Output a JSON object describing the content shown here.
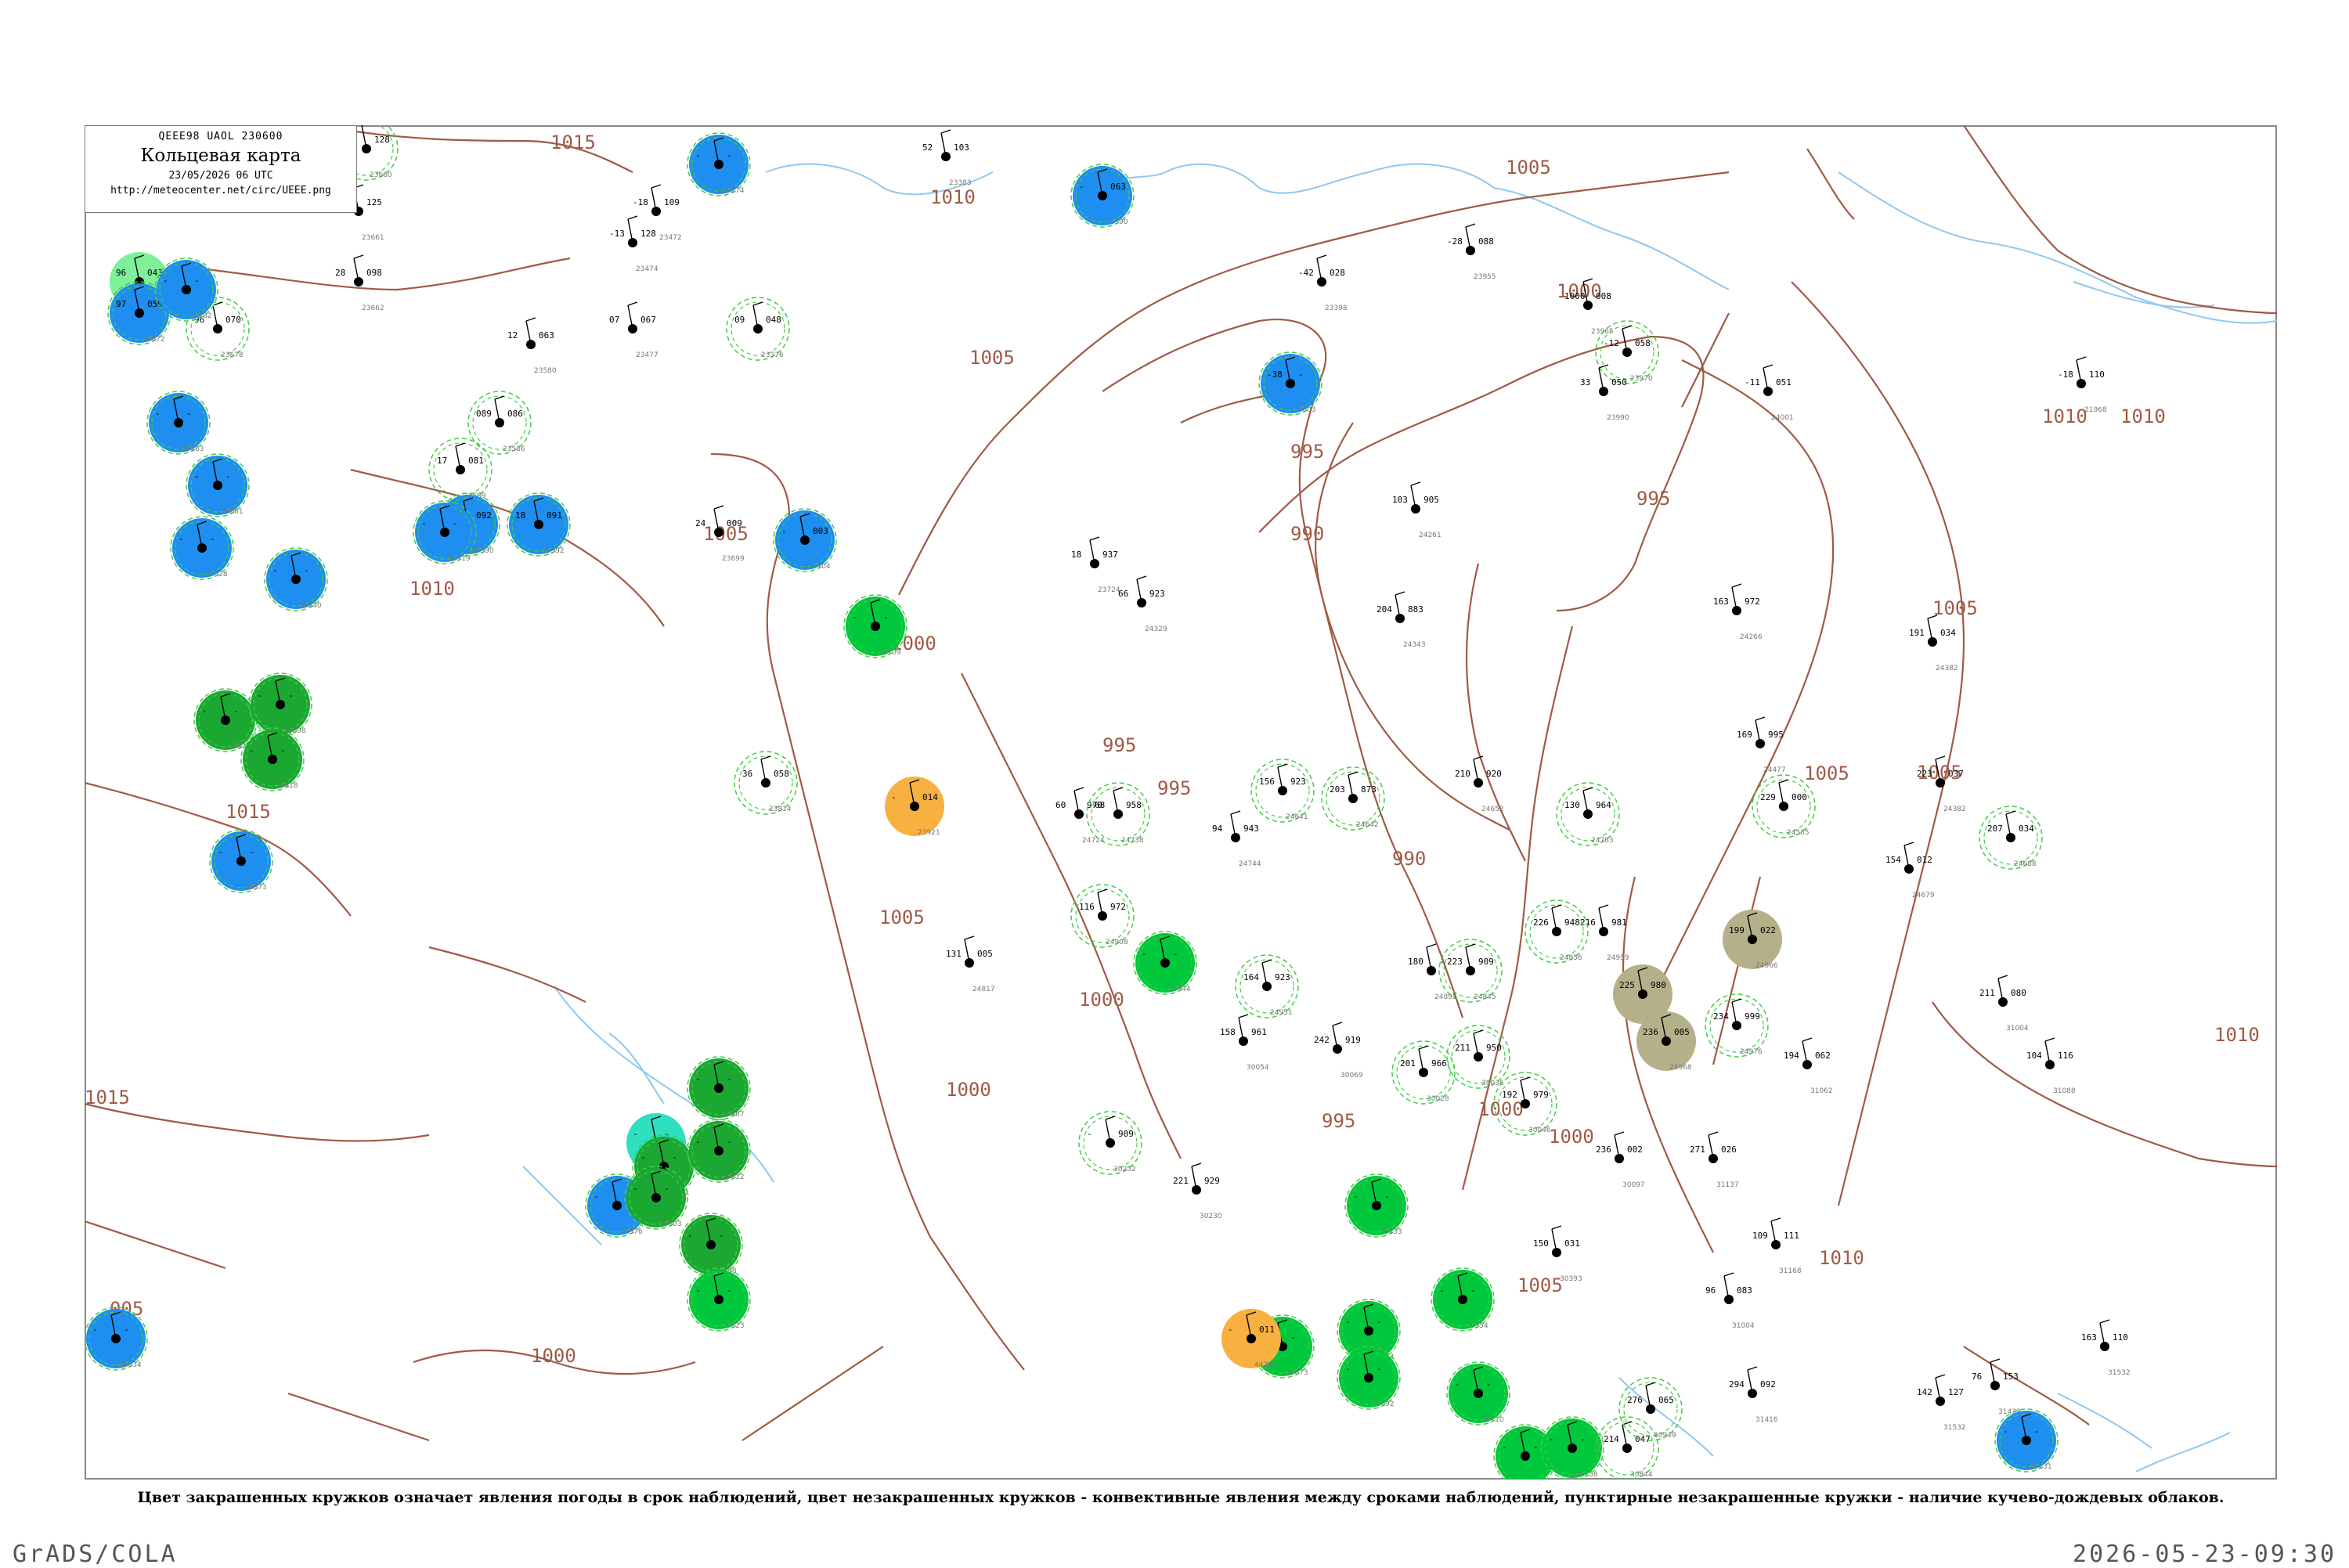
{
  "header": {
    "codes": "QEEE98  UAOL  230600",
    "title": "Кольцевая карта",
    "datetime": "23/05/2026 06 UTC",
    "url": "http://meteocenter.net/circ/UEEE.png"
  },
  "caption": "Цвет закрашенных кружков означает явления погоды в срок наблюдений, цвет незакрашенных кружков - конвективные явления между сроками наблюдений, пунктирные незакрашенные кружки - наличие кучево-дождевых облаков.",
  "footer": {
    "left": "GrADS/COLA",
    "right": "2026-05-23-09:30"
  },
  "colors": {
    "isobar": "#a05a46",
    "water": "#8ec8f0",
    "rain": "#1aa832",
    "shower": "#1e8ff0",
    "thunder_green": "#00c83c",
    "fog_tan": "#b4b08a",
    "dust_orange": "#f8b040",
    "drizzle_cyan": "#2ee0c0",
    "light_green": "#7ef09a",
    "cb_dashed": "#44cc44"
  },
  "map": {
    "isobar_labels": [
      "1015",
      "1010",
      "1005",
      "1000",
      "995",
      "990",
      "1005",
      "1010",
      "1015",
      "1005",
      "1000",
      "995",
      "990",
      "1000",
      "1005",
      "1010",
      "1000",
      "1005",
      "1010",
      "995",
      "1000",
      "995",
      "1005",
      "1000",
      "1005",
      "1010",
      "1005",
      "995",
      "1000",
      "1010",
      "1015",
      "005"
    ],
    "stations": [
      {
        "id": "23660",
        "t": "-",
        "p": "128",
        "kind": "cb"
      },
      {
        "id": "23661",
        "t": "23",
        "p": "125",
        "kind": "none"
      },
      {
        "id": "23662",
        "t": "28",
        "p": "098",
        "kind": "none"
      },
      {
        "id": "23671",
        "t": "96",
        "p": "043",
        "kind": "light_green"
      },
      {
        "id": "23672",
        "t": "97",
        "p": "059",
        "kind": "shower"
      },
      {
        "id": "23678",
        "t": "96",
        "p": "070",
        "kind": "cb"
      },
      {
        "id": "23580",
        "t": "12",
        "p": "063",
        "kind": "none"
      },
      {
        "id": "23586",
        "t": "089",
        "p": "086",
        "kind": "cb"
      },
      {
        "id": "23589",
        "t": "17",
        "p": "081",
        "kind": "cb"
      },
      {
        "id": "23590",
        "t": "17",
        "p": "092",
        "kind": "shower"
      },
      {
        "id": "23592",
        "t": "18",
        "p": "091",
        "kind": "shower"
      },
      {
        "id": "23472",
        "t": "-18",
        "p": "109",
        "kind": "none"
      },
      {
        "id": "23474",
        "t": "-13",
        "p": "128",
        "kind": "none"
      },
      {
        "id": "23477",
        "t": "07",
        "p": "067",
        "kind": "none"
      },
      {
        "id": "23274",
        "t": "-",
        "p": "-",
        "kind": "shower"
      },
      {
        "id": "23376",
        "t": "09",
        "p": "048",
        "kind": "cb"
      },
      {
        "id": "23383",
        "t": "52",
        "p": "103",
        "kind": "none"
      },
      {
        "id": "23390",
        "t": "-",
        "p": "063",
        "kind": "shower"
      },
      {
        "id": "23398",
        "t": "-42",
        "p": "028",
        "kind": "none"
      },
      {
        "id": "23803",
        "t": "-38",
        "p": "-",
        "kind": "shower"
      },
      {
        "id": "23955",
        "t": "-28",
        "p": "088",
        "kind": "none"
      },
      {
        "id": "23965",
        "t": "1000",
        "p": "008",
        "kind": "none"
      },
      {
        "id": "23970",
        "t": "-12",
        "p": "058",
        "kind": "cb"
      },
      {
        "id": "23990",
        "t": "33",
        "p": "050",
        "kind": "none"
      },
      {
        "id": "24001",
        "t": "-11",
        "p": "051",
        "kind": "none"
      },
      {
        "id": "21968",
        "t": "-18",
        "p": "110",
        "kind": "none"
      },
      {
        "id": "23699",
        "t": "24",
        "p": "009",
        "kind": "none"
      },
      {
        "id": "23704",
        "t": "-",
        "p": "003",
        "kind": "shower"
      },
      {
        "id": "23709",
        "t": "-",
        "p": "-",
        "kind": "thunder_green"
      },
      {
        "id": "23724",
        "t": "18",
        "p": "937",
        "kind": "none"
      },
      {
        "id": "24329",
        "t": "66",
        "p": "923",
        "kind": "none"
      },
      {
        "id": "24261",
        "t": "103",
        "p": "905",
        "kind": "none"
      },
      {
        "id": "24343",
        "t": "204",
        "p": "883",
        "kind": "none"
      },
      {
        "id": "24266",
        "t": "163",
        "p": "972",
        "kind": "none"
      },
      {
        "id": "24382",
        "t": "191",
        "p": "034",
        "kind": "none"
      },
      {
        "id": "23814",
        "t": "36",
        "p": "058",
        "kind": "cb"
      },
      {
        "id": "23921",
        "t": "-",
        "p": "014",
        "kind": "dust_orange"
      },
      {
        "id": "24724",
        "t": "60",
        "p": "970",
        "kind": "none"
      },
      {
        "id": "24738",
        "t": "68",
        "p": "958",
        "kind": "cb"
      },
      {
        "id": "24744",
        "t": "94",
        "p": "943",
        "kind": "none"
      },
      {
        "id": "24641",
        "t": "156",
        "p": "923",
        "kind": "cb"
      },
      {
        "id": "24642",
        "t": "203",
        "p": "873",
        "kind": "cb"
      },
      {
        "id": "24652",
        "t": "210",
        "p": "920",
        "kind": "none"
      },
      {
        "id": "24763",
        "t": "130",
        "p": "964",
        "kind": "cb"
      },
      {
        "id": "24477",
        "t": "169",
        "p": "995",
        "kind": "none"
      },
      {
        "id": "24585",
        "t": "229",
        "p": "000",
        "kind": "cb"
      },
      {
        "id": "24679",
        "t": "154",
        "p": "012",
        "kind": "none"
      },
      {
        "id": "24688",
        "t": "207",
        "p": "034",
        "kind": "cb"
      },
      {
        "id": "24382b",
        "t": "223",
        "p": "037",
        "kind": "none"
      },
      {
        "id": "24817",
        "t": "131",
        "p": "005",
        "kind": "none"
      },
      {
        "id": "24908",
        "t": "116",
        "p": "972",
        "kind": "cb"
      },
      {
        "id": "24944",
        "t": "-",
        "p": "-",
        "kind": "thunder_green"
      },
      {
        "id": "24951",
        "t": "164",
        "p": "923",
        "kind": "cb"
      },
      {
        "id": "24959",
        "t": "216",
        "p": "981",
        "kind": "none"
      },
      {
        "id": "24966",
        "t": "199",
        "p": "022",
        "kind": "fog_tan"
      },
      {
        "id": "24967",
        "t": "225",
        "p": "980",
        "kind": "fog_tan"
      },
      {
        "id": "24968",
        "t": "236",
        "p": "005",
        "kind": "fog_tan"
      },
      {
        "id": "24976",
        "t": "234",
        "p": "999",
        "kind": "cb"
      },
      {
        "id": "24856",
        "t": "226",
        "p": "948",
        "kind": "cb"
      },
      {
        "id": "24845",
        "t": "223",
        "p": "909",
        "kind": "cb"
      },
      {
        "id": "24895",
        "t": "180",
        "p": "-",
        "kind": "none"
      },
      {
        "id": "31004",
        "t": "211",
        "p": "080",
        "kind": "none"
      },
      {
        "id": "31088",
        "t": "104",
        "p": "116",
        "kind": "none"
      },
      {
        "id": "31062",
        "t": "194",
        "p": "062",
        "kind": "none"
      },
      {
        "id": "30054",
        "t": "158",
        "p": "961",
        "kind": "none"
      },
      {
        "id": "30069",
        "t": "242",
        "p": "919",
        "kind": "none"
      },
      {
        "id": "30028",
        "t": "201",
        "p": "966",
        "kind": "cb"
      },
      {
        "id": "30036",
        "t": "211",
        "p": "950",
        "kind": "cb"
      },
      {
        "id": "30046",
        "t": "192",
        "p": "979",
        "kind": "cb"
      },
      {
        "id": "30097",
        "t": "236",
        "p": "002",
        "kind": "none"
      },
      {
        "id": "31137",
        "t": "271",
        "p": "026",
        "kind": "none"
      },
      {
        "id": "30252",
        "t": "-",
        "p": "909",
        "kind": "cb"
      },
      {
        "id": "30230",
        "t": "221",
        "p": "929",
        "kind": "none"
      },
      {
        "id": "30433",
        "t": "-",
        "p": "-",
        "kind": "thunder_green"
      },
      {
        "id": "30393",
        "t": "150",
        "p": "031",
        "kind": "none"
      },
      {
        "id": "31168",
        "t": "109",
        "p": "111",
        "kind": "none"
      },
      {
        "id": "31004b",
        "t": "96",
        "p": "083",
        "kind": "none"
      },
      {
        "id": "30554",
        "t": "-",
        "p": "-",
        "kind": "thunder_green"
      },
      {
        "id": "30664",
        "t": "-",
        "p": "-",
        "kind": "thunder_green"
      },
      {
        "id": "30673",
        "t": "-",
        "p": "-",
        "kind": "thunder_green"
      },
      {
        "id": "30692",
        "t": "-",
        "p": "-",
        "kind": "thunder_green"
      },
      {
        "id": "30710",
        "t": "-",
        "p": "-",
        "kind": "thunder_green"
      },
      {
        "id": "30739",
        "t": "-",
        "p": "-",
        "kind": "thunder_green"
      },
      {
        "id": "30758",
        "t": "-",
        "p": "-",
        "kind": "thunder_green"
      },
      {
        "id": "30844",
        "t": "214",
        "p": "047",
        "kind": "cb"
      },
      {
        "id": "30949",
        "t": "276",
        "p": "065",
        "kind": "cb"
      },
      {
        "id": "31416",
        "t": "294",
        "p": "092",
        "kind": "none"
      },
      {
        "id": "31532",
        "t": "142",
        "p": "127",
        "kind": "none"
      },
      {
        "id": "31532b",
        "t": "163",
        "p": "110",
        "kind": "none"
      },
      {
        "id": "31439",
        "t": "76",
        "p": "153",
        "kind": "none"
      },
      {
        "id": "29231",
        "t": "-",
        "p": "-",
        "kind": "shower"
      },
      {
        "id": "29282",
        "t": "-",
        "p": "-",
        "kind": "shower"
      },
      {
        "id": "29263",
        "t": "-",
        "p": "-",
        "kind": "shower"
      },
      {
        "id": "29328",
        "t": "-",
        "p": "-",
        "kind": "shower"
      },
      {
        "id": "29430",
        "t": "-",
        "p": "-",
        "kind": "rain"
      },
      {
        "id": "29467",
        "t": "-",
        "p": "-",
        "kind": "rain"
      },
      {
        "id": "29570",
        "t": "-",
        "p": "-",
        "kind": "drizzle_cyan"
      },
      {
        "id": "29576",
        "t": "-",
        "p": "-",
        "kind": "shower"
      },
      {
        "id": "29581",
        "t": "-",
        "p": "-",
        "kind": "rain"
      },
      {
        "id": "29603",
        "t": "-",
        "p": "-",
        "kind": "rain"
      },
      {
        "id": "29612",
        "t": "-",
        "p": "-",
        "kind": "rain"
      },
      {
        "id": "29698",
        "t": "-",
        "p": "-",
        "kind": "rain"
      },
      {
        "id": "30823",
        "t": "-",
        "p": "-",
        "kind": "thunder_green"
      },
      {
        "id": "44231",
        "t": "-",
        "p": "011",
        "kind": "dust_orange"
      },
      {
        "id": "36034",
        "t": "-",
        "p": "-",
        "kind": "shower"
      },
      {
        "id": "28698",
        "t": "-",
        "p": "-",
        "kind": "rain"
      },
      {
        "id": "28661",
        "t": "-",
        "p": "-",
        "kind": "shower"
      },
      {
        "id": "28440",
        "t": "-",
        "p": "-",
        "kind": "shower"
      },
      {
        "id": "28418",
        "t": "-",
        "p": "-",
        "kind": "rain"
      },
      {
        "id": "28573",
        "t": "-",
        "p": "-",
        "kind": "shower"
      },
      {
        "id": "28719",
        "t": "-",
        "p": "-",
        "kind": "shower"
      }
    ]
  }
}
